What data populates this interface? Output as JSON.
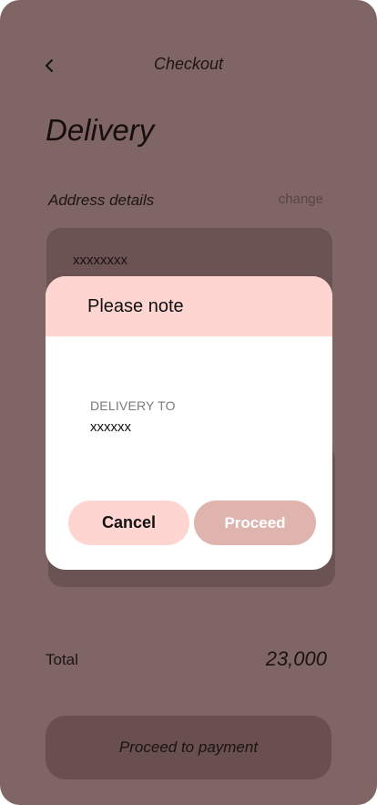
{
  "header": {
    "title": "Checkout",
    "back_icon": "chevron-left-icon"
  },
  "main": {
    "section_title": "Delivery",
    "address_label": "Address details",
    "change_label": "change",
    "address_text": "xxxxxxxx",
    "total_label": "Total",
    "total_value": "23,000",
    "pay_button_label": "Proceed to payment"
  },
  "modal": {
    "title": "Please note",
    "subtitle": "DELIVERY TO",
    "value": "xxxxxx",
    "cancel_label": "Cancel",
    "proceed_label": "Proceed"
  },
  "colors": {
    "background_overlay": "#7f6664",
    "modal_header": "#ffd5d1",
    "cancel_button": "#ffd5d1",
    "proceed_button": "#dfb4ae"
  }
}
